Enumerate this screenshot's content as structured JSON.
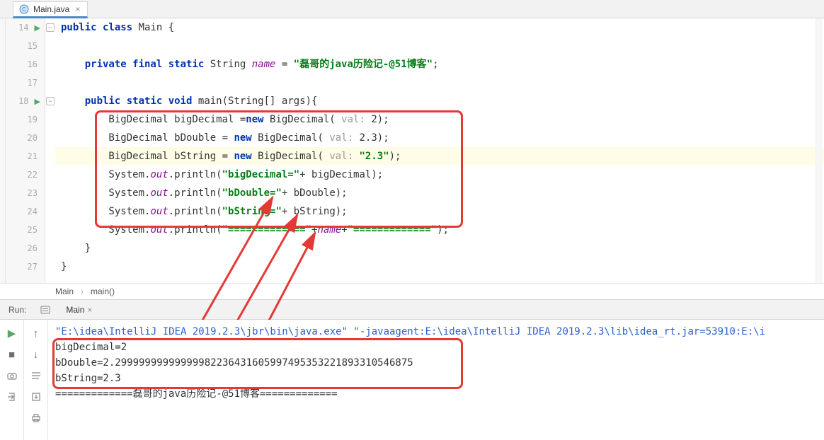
{
  "tab": {
    "label": "Main.java"
  },
  "gutter": {
    "lines": [
      "14",
      "15",
      "16",
      "17",
      "18",
      "19",
      "20",
      "21",
      "22",
      "23",
      "24",
      "25",
      "26",
      "27"
    ]
  },
  "code": {
    "l14_a": "public",
    "l14_b": " class",
    "l14_c": " Main {",
    "l16_a": "    private",
    "l16_b": " final",
    "l16_c": " static",
    "l16_d": " String ",
    "l16_e": "name",
    "l16_f": " = ",
    "l16_g": "\"磊哥的java历险记-@51博客\"",
    "l16_h": ";",
    "l18_a": "    public",
    "l18_b": " static",
    "l18_c": " void",
    "l18_d": " main(String[] args){",
    "l19_a": "        BigDecimal bigDecimal =",
    "l19_b": "new",
    "l19_c": " BigDecimal(",
    "l19_d": " val: ",
    "l19_e": "2",
    "l19_f": ");",
    "l20_a": "        BigDecimal bDouble = ",
    "l20_b": "new",
    "l20_c": " BigDecimal(",
    "l20_d": " val: ",
    "l20_e": "2.3",
    "l20_f": ");",
    "l21_a": "        BigDecimal bString = ",
    "l21_b": "new",
    "l21_c": " BigDecimal(",
    "l21_d": " val: ",
    "l21_e": "\"2.3\"",
    "l21_f": ");",
    "l22_a": "        System.",
    "l22_b": "out",
    "l22_c": ".println(",
    "l22_d": "\"bigDecimal=\"",
    "l22_e": "+ bigDecimal);",
    "l23_a": "        System.",
    "l23_b": "out",
    "l23_c": ".println(",
    "l23_d": "\"bDouble=\"",
    "l23_e": "+ bDouble);",
    "l24_a": "        System.",
    "l24_b": "out",
    "l24_c": ".println(",
    "l24_d": "\"bString=\"",
    "l24_e": "+ bString);",
    "l25_a": "        System.",
    "l25_b": "out",
    "l25_c": ".println(",
    "l25_d": "\"=============\"",
    "l25_e": "+",
    "l25_f": "name",
    "l25_g": "+",
    "l25_h": "\"=============\"",
    "l25_i": ");",
    "l26": "    }",
    "l27": "}"
  },
  "breadcrumb": {
    "a": "Main",
    "b": "main()"
  },
  "run": {
    "label": "Run:",
    "tab": "Main"
  },
  "console": {
    "cmd": "\"E:\\idea\\IntelliJ IDEA 2019.2.3\\jbr\\bin\\java.exe\" \"-javaagent:E:\\idea\\IntelliJ IDEA 2019.2.3\\lib\\idea_rt.jar=53910:E:\\i",
    "l1": "bigDecimal=2",
    "l2": "bDouble=2.29999999999999982236431605997495353221893310546875",
    "l3": "bString=2.3",
    "l4": "=============磊哥的java历险记-@51博客============="
  }
}
